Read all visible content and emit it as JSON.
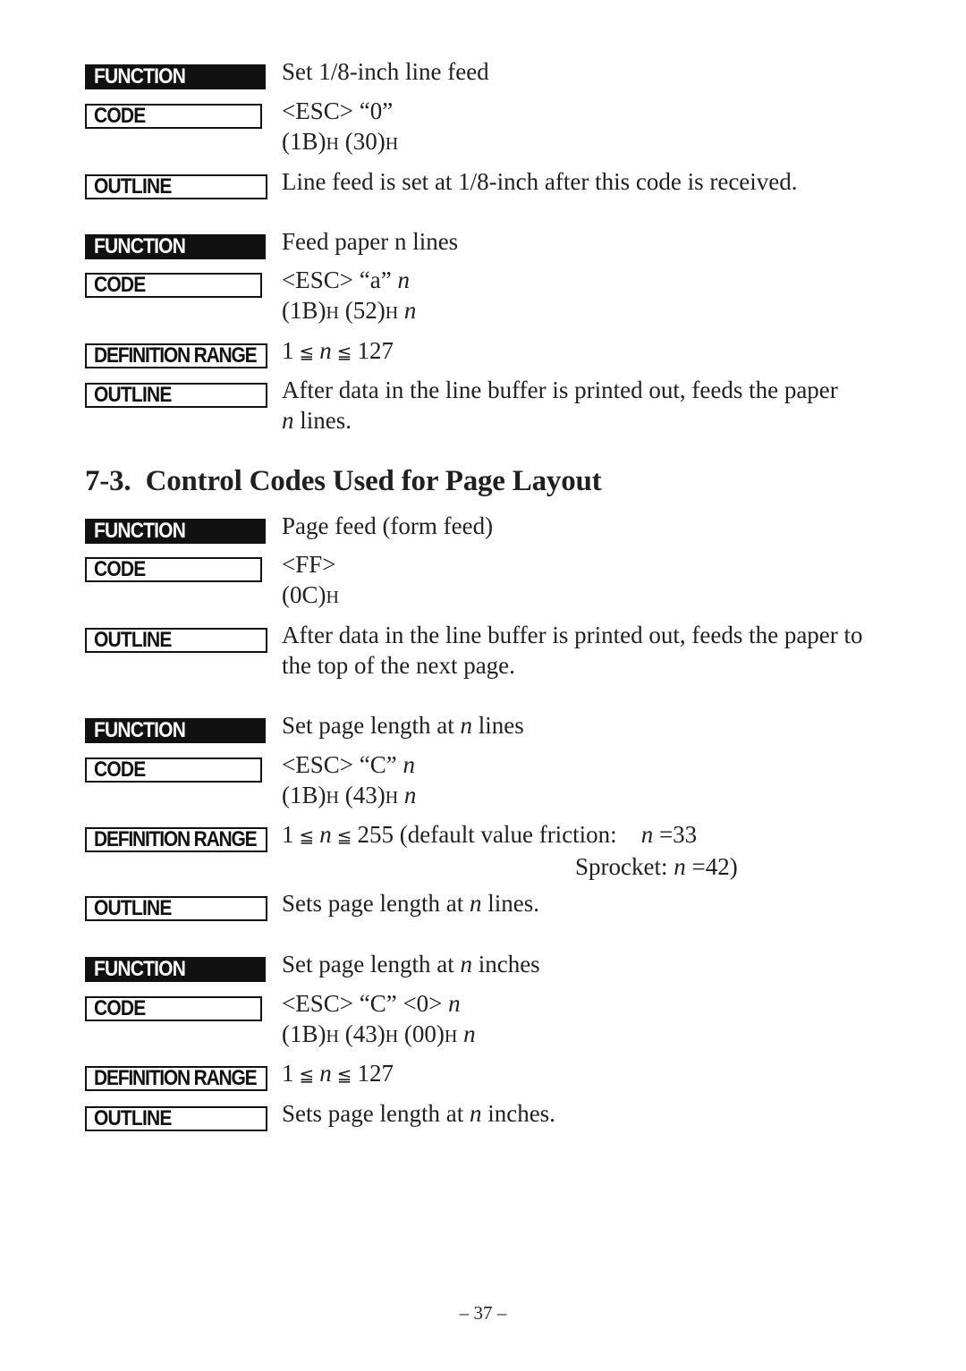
{
  "labels": {
    "function": "FUNCTION",
    "code": "CODE",
    "definition_range": "DEFINITION RANGE",
    "outline": "OUTLINE"
  },
  "blocks": [
    {
      "function": "Set 1/8-inch line feed",
      "code_line1": "<ESC> “0”",
      "code_hex": [
        "(1B)",
        "H",
        " (30)",
        "H"
      ],
      "outline": "Line feed is set at 1/8-inch after this code is received."
    },
    {
      "function": "Feed paper n lines",
      "code_line1": "<ESC> “a” ",
      "code_line1_var": "n",
      "code_hex": [
        "(1B)",
        "H",
        " (52)",
        "H"
      ],
      "code_hex_var": "n",
      "range": {
        "min": "1",
        "leq": "≦",
        "var": "n",
        "max": "127"
      },
      "outline_line1": "After data in the line buffer is printed out, feeds the paper",
      "outline_line2_var": "n",
      "outline_line2": " lines."
    }
  ],
  "section": {
    "number": "7-3.",
    "title": "Control Codes Used for Page Layout"
  },
  "section_blocks": [
    {
      "function": "Page feed (form feed)",
      "code_line1": "<FF>",
      "code_hex": [
        "(0C)",
        "H"
      ],
      "outline_line1": "After data in the line buffer is printed out, feeds the paper to",
      "outline_line2": "the top of the next page."
    },
    {
      "function_pre": "Set page length at ",
      "function_var": "n",
      "function_post": " lines",
      "code_line1": "<ESC> “C” ",
      "code_line1_var": "n",
      "code_hex": [
        "(1B)",
        "H",
        " (43)",
        "H"
      ],
      "code_hex_var": "n",
      "range": {
        "min": "1",
        "leq": "≦",
        "var": "n",
        "max": "255"
      },
      "range_note": " (default value friction:",
      "friction_var": "n",
      "friction_value": " =33",
      "sprocket_label": "Sprocket: ",
      "sprocket_var": "n",
      "sprocket_value": " =42)",
      "outline_pre": "Sets page length at ",
      "outline_var": "n",
      "outline_post": " lines."
    },
    {
      "function_pre": "Set page length at ",
      "function_var": "n",
      "function_post": " inches",
      "code_line1": "<ESC> “C” <0> ",
      "code_line1_var": "n",
      "code_hex": [
        "(1B)",
        "H",
        " (43)",
        "H",
        " (00)",
        "H"
      ],
      "code_hex_var": "n",
      "range": {
        "min": "1",
        "leq": "≦",
        "var": "n",
        "max": "127"
      },
      "outline_pre": "Sets page length at ",
      "outline_var": "n",
      "outline_post": " inches."
    }
  ],
  "footer": {
    "page_number": "– 37 –"
  }
}
